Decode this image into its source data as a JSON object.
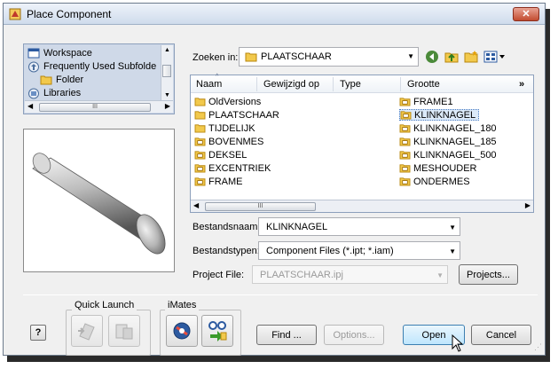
{
  "window": {
    "title": "Place Component",
    "close_glyph": "✕"
  },
  "tree": {
    "items": [
      {
        "label": "Workspace",
        "icon": "workspace-icon"
      },
      {
        "label": "Frequently Used Subfolde",
        "icon": "subfolder-icon"
      },
      {
        "label": "Folder",
        "icon": "folder-icon"
      },
      {
        "label": "Libraries",
        "icon": "library-icon"
      }
    ],
    "scroll_glyph": "III"
  },
  "lookin": {
    "label": "Zoeken in:",
    "value": "PLAATSCHAAR"
  },
  "columns": [
    "Naam",
    "Gewijzigd op",
    "Type",
    "Grootte"
  ],
  "files_left": [
    {
      "name": "OldVersions",
      "kind": "folder"
    },
    {
      "name": "PLAATSCHAAR",
      "kind": "folder"
    },
    {
      "name": "TIJDELIJK",
      "kind": "folder"
    },
    {
      "name": "BOVENMES",
      "kind": "part"
    },
    {
      "name": "DEKSEL",
      "kind": "part"
    },
    {
      "name": "EXCENTRIEK",
      "kind": "part"
    },
    {
      "name": "FRAME",
      "kind": "part"
    }
  ],
  "files_right": [
    {
      "name": "FRAME1",
      "kind": "part"
    },
    {
      "name": "KLINKNAGEL",
      "kind": "part",
      "selected": true
    },
    {
      "name": "KLINKNAGEL_180",
      "kind": "part"
    },
    {
      "name": "KLINKNAGEL_185",
      "kind": "part"
    },
    {
      "name": "KLINKNAGEL_500",
      "kind": "part"
    },
    {
      "name": "MESHOUDER",
      "kind": "part"
    },
    {
      "name": "ONDERMES",
      "kind": "part"
    }
  ],
  "filename": {
    "label": "Bestandsnaam:",
    "value": "KLINKNAGEL"
  },
  "filetype": {
    "label": "Bestandstypen:",
    "value": "Component Files (*.ipt; *.iam)"
  },
  "project": {
    "label": "Project File:",
    "value": "PLAATSCHAAR.ipj",
    "button": "Projects..."
  },
  "bottom": {
    "quick_launch": "Quick Launch",
    "imates": "iMates",
    "help_glyph": "?",
    "find": "Find ...",
    "options": "Options...",
    "open": "Open",
    "cancel": "Cancel"
  },
  "more_columns_glyph": "»"
}
